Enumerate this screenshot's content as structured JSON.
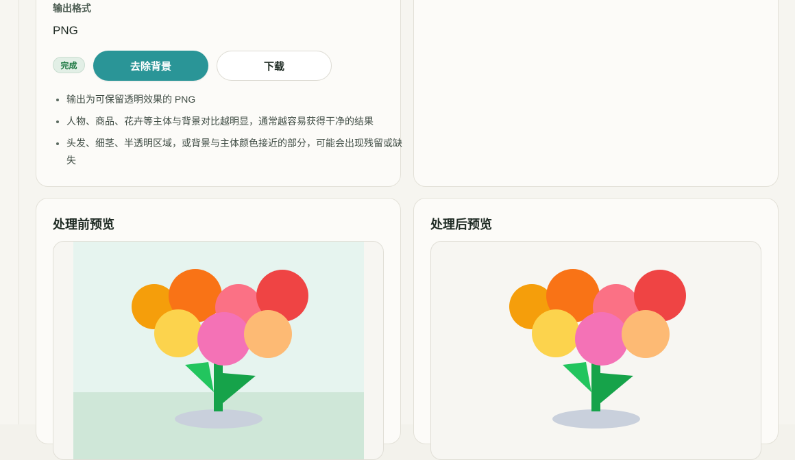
{
  "settings": {
    "output_format_label": "输出格式",
    "output_format_value": "PNG",
    "status_badge": "完成",
    "remove_bg_button": "去除背景",
    "download_button": "下载",
    "notes": [
      "输出为可保留透明效果的 PNG",
      "人物、商品、花卉等主体与背景对比越明显，通常越容易获得干净的结果",
      "头发、细茎、半透明区域，或背景与主体颜色接近的部分，可能会出现残留或缺失"
    ]
  },
  "preview_before": {
    "title": "处理前预览"
  },
  "preview_after": {
    "title": "处理后预览"
  },
  "colors": {
    "accent": "#2a9597",
    "badge_text": "#1f7a44",
    "sky": "#e6f4ef",
    "ground": "#cfe7d8",
    "pot": "#c9d0dc",
    "stem": "#16a34a",
    "leaf": "#22c55e",
    "flower_orange_dark": "#f59e0b",
    "flower_orange": "#f97316",
    "flower_pink_light": "#fb7185",
    "flower_red": "#ef4444",
    "flower_yellow": "#fcd34d",
    "flower_pink": "#f472b6",
    "flower_peach": "#fdba74"
  }
}
